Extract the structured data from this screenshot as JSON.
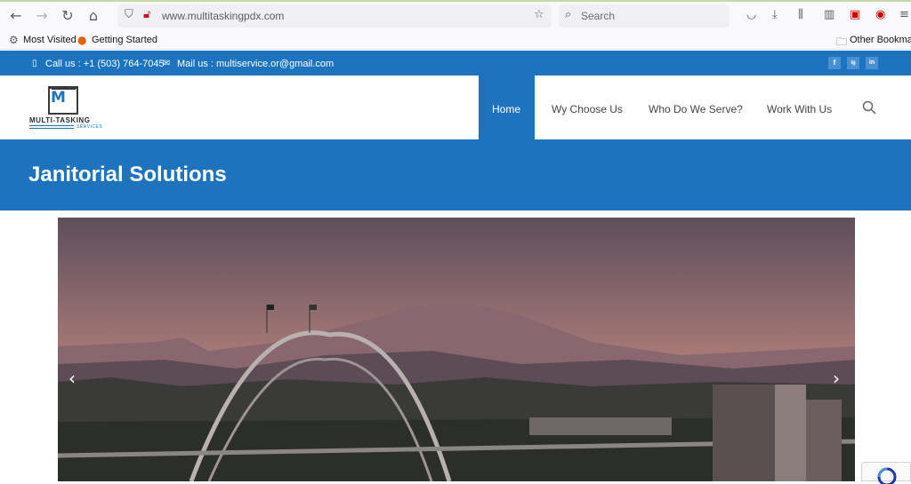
{
  "browser": {
    "url": "www.multitaskingpdx.com",
    "search_placeholder": "Search",
    "bookmarks": [
      "Most Visited",
      "Getting Started"
    ],
    "other_bookmarks": "Other Bookmarks"
  },
  "topbar": {
    "call": "Call us : +1 (503) 764-7045",
    "mail": "Mail us : multiservice.or@gmail.com",
    "social": [
      "f",
      "ig",
      "in"
    ]
  },
  "logo": {
    "name": "MULTI-TASKING",
    "sub": "SERVICES"
  },
  "nav": {
    "items": [
      "Home",
      "Wy Choose Us",
      "Who Do We Serve?",
      "Work With Us"
    ]
  },
  "hero": {
    "title": "Janitorial Solutions"
  },
  "slider": {
    "prev": "‹",
    "next": "›"
  },
  "colors": {
    "brand_blue": "#1e73be"
  }
}
